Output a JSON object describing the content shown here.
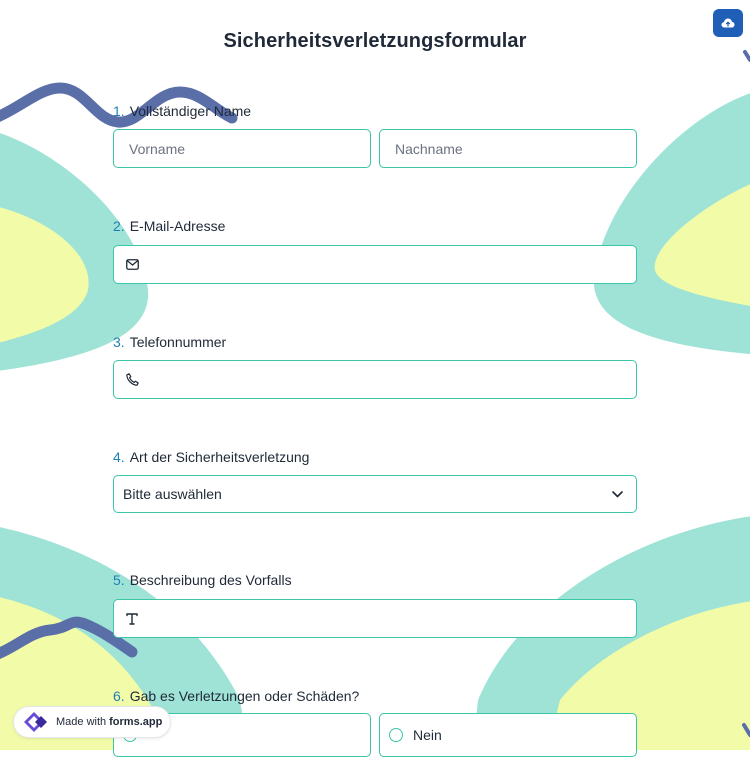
{
  "form": {
    "title": "Sicherheitsverletzungsformular"
  },
  "questions": [
    {
      "number": "1.",
      "label": "Vollständiger Name",
      "first_placeholder": "Vorname",
      "last_placeholder": "Nachname"
    },
    {
      "number": "2.",
      "label": "E-Mail-Adresse",
      "icon": "envelope-icon"
    },
    {
      "number": "3.",
      "label": "Telefonnummer",
      "icon": "phone-icon"
    },
    {
      "number": "4.",
      "label": "Art der Sicherheitsverletzung",
      "selected": "Bitte auswählen",
      "icon": "chevron-down-icon"
    },
    {
      "number": "5.",
      "label": "Beschreibung des Vorfalls",
      "icon": "text-icon"
    },
    {
      "number": "6.",
      "label": "Gab es Verletzungen oder Schäden?",
      "options": [
        "",
        "Nein"
      ]
    }
  ],
  "badge": {
    "prefix": "Made with",
    "brand": "forms.app"
  },
  "colors": {
    "accent_border": "#3cc6a8",
    "number_blue": "#1f7fb5",
    "save_button": "#1f5fb8",
    "bg_teal": "#9ee3d6",
    "bg_yellow": "#f1fba8",
    "bg_navy": "#5a6ea8"
  },
  "icons": {
    "save": "cloud-upload-icon",
    "badge_logo": "forms-app-logo-icon"
  }
}
